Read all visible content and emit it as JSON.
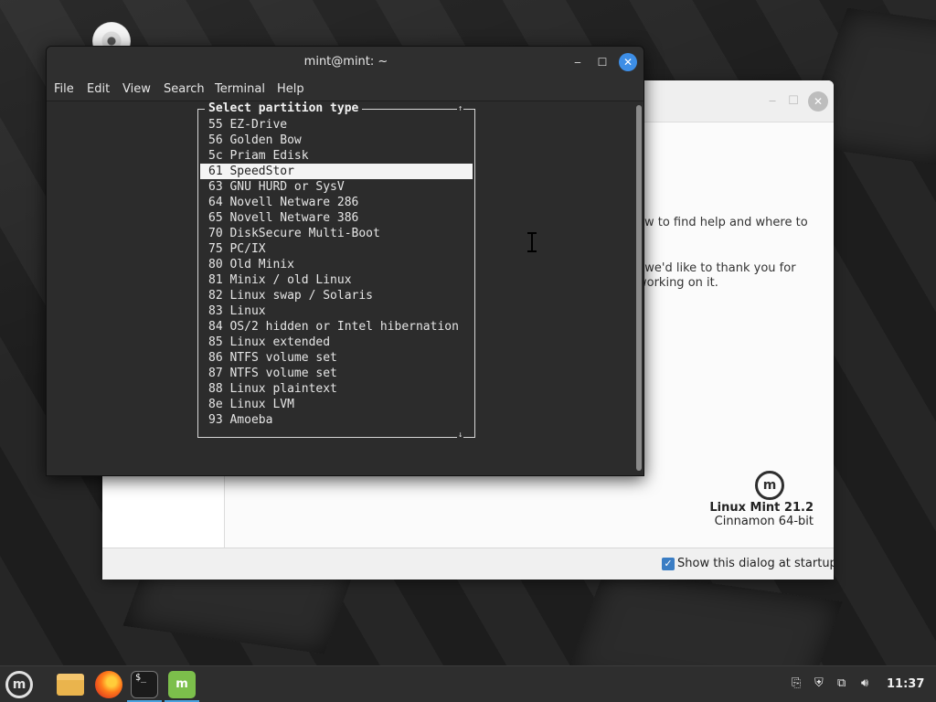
{
  "terminal": {
    "title": "mint@mint: ~",
    "menu": [
      "File",
      "Edit",
      "View",
      "Search",
      "Terminal",
      "Help"
    ],
    "dialog": {
      "title": "Select partition type",
      "items": [
        "55 EZ-Drive",
        "56 Golden Bow",
        "5c Priam Edisk",
        "61 SpeedStor",
        "63 GNU HURD or SysV",
        "64 Novell Netware 286",
        "65 Novell Netware 386",
        "70 DiskSecure Multi-Boot",
        "75 PC/IX",
        "80 Old Minix",
        "81 Minix / old Linux",
        "82 Linux swap / Solaris",
        "83 Linux",
        "84 OS/2 hidden or Intel hibernation",
        "85 Linux extended",
        "86 NTFS volume set",
        "87 NTFS volume set",
        "88 Linux plaintext",
        "8e Linux LVM",
        "93 Amoeba"
      ],
      "selected_index": 3,
      "arrow_up": "↑",
      "arrow_down": "↓"
    }
  },
  "welcome": {
    "text_line1": "ow to find help and where to",
    "text_line2": ", we'd like to thank you for",
    "text_line3": "working on it.",
    "brand_name": "Linux Mint 21.2",
    "brand_edition": "Cinnamon 64-bit",
    "show_at_startup_label": "Show this dialog at startup",
    "show_at_startup_checked": true
  },
  "taskbar": {
    "clock": "11:37"
  },
  "icons": {
    "minimize": "minimize-icon",
    "maximize": "maximize-icon",
    "close": "close-icon",
    "menu": "mint-menu-icon",
    "files": "folder-icon",
    "browser": "firefox-icon",
    "terminal": "terminal-icon",
    "installer": "mint-install-icon"
  },
  "colors": {
    "accent": "#3d8ee6",
    "selection": "#f4f4f4",
    "mint_green": "#7cbf4b"
  }
}
